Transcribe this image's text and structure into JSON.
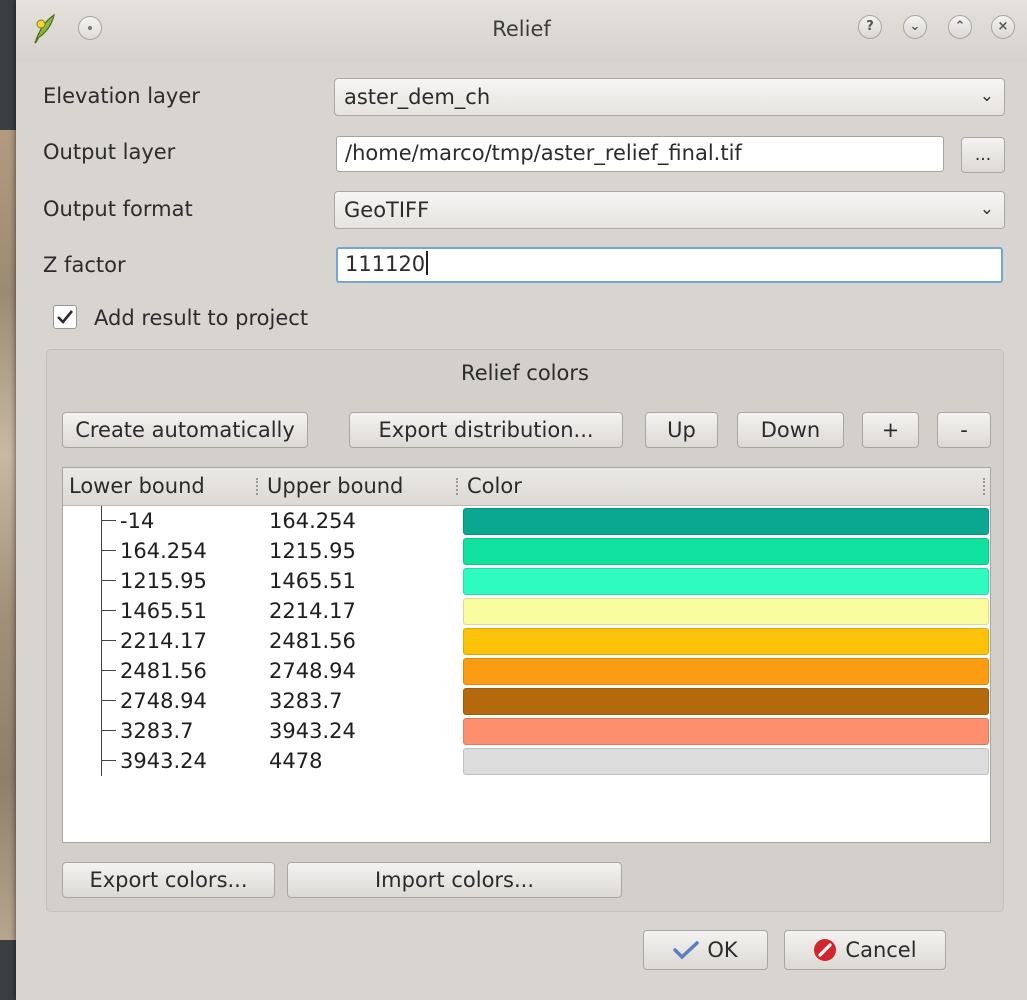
{
  "window": {
    "title": "Relief"
  },
  "form": {
    "elevation_label": "Elevation layer",
    "elevation_value": "aster_dem_ch",
    "output_label": "Output layer",
    "output_value": "/home/marco/tmp/aster_relief_final.tif",
    "browse_label": "...",
    "format_label": "Output format",
    "format_value": "GeoTIFF",
    "zfactor_label": "Z factor",
    "zfactor_value": "111120",
    "add_result_label": "Add result to project",
    "add_result_checked": true
  },
  "relief": {
    "title": "Relief colors",
    "buttons": {
      "create": "Create automatically",
      "export_dist": "Export distribution...",
      "up": "Up",
      "down": "Down",
      "plus": "+",
      "minus": "-"
    },
    "headers": {
      "lower": "Lower bound",
      "upper": "Upper bound",
      "color": "Color"
    },
    "rows": [
      {
        "lower": "-14",
        "upper": "164.254",
        "color": "#0aa890"
      },
      {
        "lower": "164.254",
        "upper": "1215.95",
        "color": "#11e19e"
      },
      {
        "lower": "1215.95",
        "upper": "1465.51",
        "color": "#2efbc0"
      },
      {
        "lower": "1465.51",
        "upper": "2214.17",
        "color": "#f9fc9e"
      },
      {
        "lower": "2214.17",
        "upper": "2481.56",
        "color": "#fcc20a"
      },
      {
        "lower": "2481.56",
        "upper": "2748.94",
        "color": "#fb9c12"
      },
      {
        "lower": "2748.94",
        "upper": "3283.7",
        "color": "#b4690c"
      },
      {
        "lower": "3283.7",
        "upper": "3943.24",
        "color": "#fd8e6e"
      },
      {
        "lower": "3943.24",
        "upper": "4478",
        "color": "#dcdcdc"
      }
    ],
    "export_colors": "Export colors...",
    "import_colors": "Import colors..."
  },
  "footer": {
    "ok": "OK",
    "cancel": "Cancel"
  }
}
